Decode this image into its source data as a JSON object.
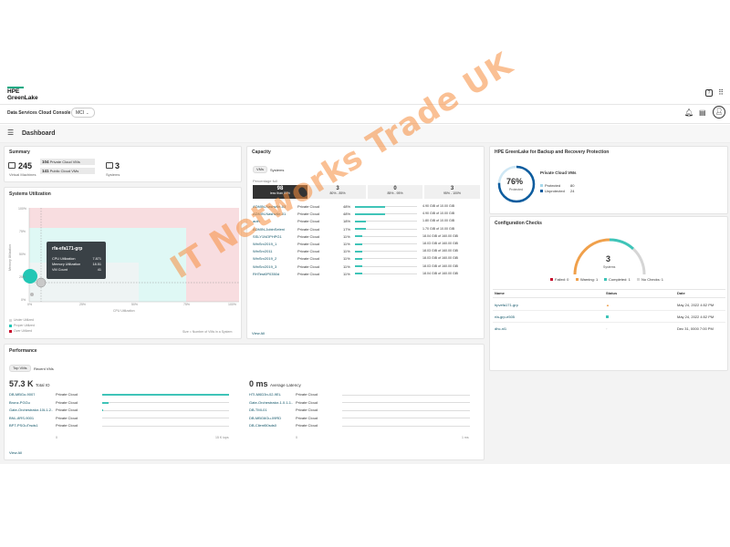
{
  "brand": {
    "line1": "HPE",
    "line2": "GreenLake"
  },
  "console": {
    "title": "Data Services Cloud Console",
    "region": "MCI"
  },
  "page": {
    "title": "Dashboard"
  },
  "summary": {
    "title": "Summary",
    "vm_count": "245",
    "vm_label": "Virtual Machines",
    "private_count": "104",
    "private_label": "Private Cloud VMs",
    "public_count": "141",
    "public_label": "Public Cloud VMs",
    "systems_count": "3",
    "systems_label": "Systems"
  },
  "utilization": {
    "title": "Systems Utilization",
    "y_ticks": [
      "100%",
      "75%",
      "50%",
      "25%",
      "0%"
    ],
    "x_ticks": [
      "0%",
      "25%",
      "50%",
      "75%",
      "100%"
    ],
    "x_label": "CPU Utilization",
    "y_label": "Memory Utilization",
    "tooltip": {
      "name": "rfa-efa171-grp",
      "rows": [
        {
          "label": "CPU Utilization",
          "value": "7.871"
        },
        {
          "label": "Memory Utilization",
          "value": "18.51"
        },
        {
          "label": "VM Count",
          "value": "41"
        }
      ]
    },
    "legend": [
      "Under Utilized",
      "Proper Utilized",
      "Over Utilized"
    ],
    "footnote": "Size = Number of VMs in a System",
    "colors": {
      "under": "#d9d9d9",
      "proper": "#7fe1d4",
      "over": "#e48a96"
    }
  },
  "capacity": {
    "title": "Capacity",
    "tabs": [
      "VMs",
      "Systems"
    ],
    "subtitle": "Percentage full",
    "buckets": [
      {
        "count": "98",
        "label": "less than 80%"
      },
      {
        "count": "3",
        "label": "80% - 85%"
      },
      {
        "count": "0",
        "label": "85% - 95%"
      },
      {
        "count": "3",
        "label": "95% - 100%"
      }
    ],
    "rows": [
      {
        "name": "ADMIN-Nashville-03",
        "type": "Private Cloud",
        "pct": "48%",
        "fill": 0.48,
        "size": "4.90 GiB of 10.00 GiB"
      },
      {
        "name": "ADMIN-Nashville-01",
        "type": "Private Cloud",
        "pct": "48%",
        "fill": 0.48,
        "size": "4.90 GiB of 10.00 GiB"
      },
      {
        "name": "auth",
        "type": "Private Cloud",
        "pct": "18%",
        "fill": 0.18,
        "size": "1.80 GiB of 10.00 GiB"
      },
      {
        "name": "ADMIN-JobinSeleni",
        "type": "Private Cloud",
        "pct": "17%",
        "fill": 0.17,
        "size": "1.70 GiB of 10.00 GiB"
      },
      {
        "name": "SSLY1NOPHPG1",
        "type": "Private Cloud",
        "pct": "11%",
        "fill": 0.11,
        "size": "18.04 GiB of 160.00 GiB"
      },
      {
        "name": "WinSrv2019_1",
        "type": "Private Cloud",
        "pct": "11%",
        "fill": 0.11,
        "size": "18.03 GiB of 160.00 GiB"
      },
      {
        "name": "WinSrv2011",
        "type": "Private Cloud",
        "pct": "11%",
        "fill": 0.11,
        "size": "18.03 GiB of 160.00 GiB"
      },
      {
        "name": "WinSrv2019_2",
        "type": "Private Cloud",
        "pct": "11%",
        "fill": 0.11,
        "size": "18.03 GiB of 160.00 GiB"
      },
      {
        "name": "WinSrv2019_3",
        "type": "Private Cloud",
        "pct": "11%",
        "fill": 0.11,
        "size": "18.03 GiB of 160.00 GiB"
      },
      {
        "name": "RHTest0P0350d",
        "type": "Private Cloud",
        "pct": "11%",
        "fill": 0.11,
        "size": "18.04 GiB of 160.00 GiB"
      }
    ],
    "view_all": "View All"
  },
  "protection": {
    "title": "HPE GreenLake for Backup and Recovery Protection",
    "percent": "76%",
    "percent_label": "Protected",
    "fraction": 0.76,
    "group_label": "Private Cloud VMs",
    "rows": [
      {
        "label": "Protected",
        "value": "80"
      },
      {
        "label": "Unprotected",
        "value": "24"
      }
    ]
  },
  "config": {
    "title": "Configuration Checks",
    "count": "3",
    "count_label": "Systems",
    "legend": [
      "Failed: 0",
      "Warning: 1",
      "Completed: 1",
      "No Checks: 1"
    ],
    "headers": [
      "Name",
      "Status",
      "Date"
    ],
    "rows": [
      {
        "name": "hpvefa171-grp",
        "date": "May 24, 2022 4:52 PM"
      },
      {
        "name": "rfa-grp-e505",
        "date": "May 24, 2022 4:52 PM"
      },
      {
        "name": "dhc-nl1",
        "date": "Dec 31, 0000 7:00 PM"
      }
    ]
  },
  "performance": {
    "title": "Performance",
    "tabs": [
      "Top VMs",
      "Recent VMs"
    ],
    "iops_value": "57.3 K",
    "iops_label": "Total IO",
    "latency_value": "0 ms",
    "latency_label": "Average Latency",
    "left_rows": [
      {
        "name": "DB-MBGo-9007",
        "type": "Private Cloud"
      },
      {
        "name": "Bronz-PGGu",
        "type": "Private Cloud"
      },
      {
        "name": "Gate-Orchestrator-10L1-2...",
        "type": "Private Cloud"
      },
      {
        "name": "BNL-8RS-9001",
        "type": "Private Cloud"
      },
      {
        "name": "BPT-PSGuTrsds1",
        "type": "Private Cloud"
      }
    ],
    "right_rows": [
      {
        "name": "HTI-M6D3n-02-9EL",
        "type": "Private Cloud"
      },
      {
        "name": "Gate-Orchestrator-1.0.1-1...",
        "type": "Private Cloud"
      },
      {
        "name": "DB-TMI-01",
        "type": "Private Cloud"
      },
      {
        "name": "DB-MBG6Gu-09RD",
        "type": "Private Cloud"
      },
      {
        "name": "DB-Client50sds0",
        "type": "Private Cloud"
      }
    ],
    "left_axis": [
      "0",
      "15 K iops"
    ],
    "right_axis": [
      "0",
      "1 ms"
    ],
    "view_all": "View All"
  },
  "watermark": "IT Networks Trade UK"
}
